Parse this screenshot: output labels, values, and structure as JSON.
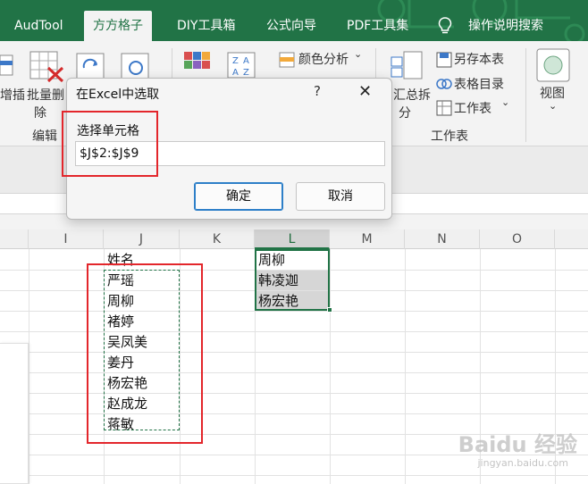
{
  "ribbon_tabs": [
    {
      "label": "AudTool"
    },
    {
      "label": "方方格子"
    },
    {
      "label": "DIY工具箱"
    },
    {
      "label": "公式向导"
    },
    {
      "label": "PDF工具集"
    },
    {
      "label": "操作说明搜索"
    }
  ],
  "ribbon": {
    "insert_label_partial": "增插",
    "batch_delete_line1": "批量删",
    "batch_delete_line2": "除",
    "group_edit": "编辑",
    "color_analysis": "颜色分析",
    "summary_split_line1": "汇总拆",
    "summary_split_line2": "分",
    "save_as_book": "另存本表",
    "sheet_directory": "表格目录",
    "worksheet_menu": "工作表",
    "group_worksheet": "工作表",
    "view": "视图"
  },
  "columns": [
    "I",
    "J",
    "K",
    "L",
    "M",
    "N",
    "O"
  ],
  "column_j": [
    "姓名",
    "严瑶",
    "周柳",
    "褚婷",
    "吴凤美",
    "姜丹",
    "杨宏艳",
    "赵成龙",
    "蒋敏"
  ],
  "column_l": [
    "周柳",
    "韩凌迦",
    "杨宏艳"
  ],
  "dialog": {
    "title": "在Excel中选取",
    "help": "?",
    "close": "✕",
    "label": "选择单元格",
    "value": "$J$2:$J$9",
    "ok": "确定",
    "cancel": "取消"
  },
  "watermark": {
    "main": "Baidu 经验",
    "sub": "jingyan.baidu.com"
  },
  "colors": {
    "excel_green": "#217346",
    "annotation_red": "#e3262b"
  }
}
